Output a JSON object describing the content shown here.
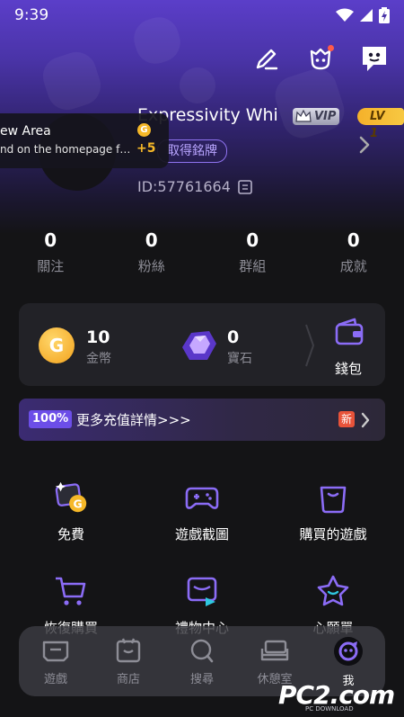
{
  "status_bar": {
    "time": "9:39"
  },
  "profile": {
    "nickname": "Expressivity Whi",
    "vip_label": "VIP",
    "level_label": "LV 1",
    "title_tag": "取得銘牌",
    "user_id": "ID:57761664"
  },
  "toast": {
    "title": "ew  Area",
    "body": "nd on the homepage for t...",
    "coin_letter": "G",
    "reward": "+5"
  },
  "stats": [
    {
      "value": "0",
      "label": "關注"
    },
    {
      "value": "0",
      "label": "粉絲"
    },
    {
      "value": "0",
      "label": "群組"
    },
    {
      "value": "0",
      "label": "成就"
    }
  ],
  "wallet": {
    "coin_letter": "G",
    "coins_value": "10",
    "coins_label": "金幣",
    "gems_value": "0",
    "gems_label": "寶石",
    "wallet_label": "錢包"
  },
  "recharge": {
    "badge": "100%",
    "text": "更多充值詳情>>>",
    "new_badge": "新"
  },
  "grid": [
    {
      "label": "免費",
      "icon": "free-gift-icon"
    },
    {
      "label": "遊戲截圖",
      "icon": "gamepad-icon"
    },
    {
      "label": "購買的遊戲",
      "icon": "shopping-bag-icon"
    },
    {
      "label": "恢復購買",
      "icon": "cart-icon"
    },
    {
      "label": "禮物中心",
      "icon": "gift-center-icon"
    },
    {
      "label": "心願單",
      "icon": "wishlist-star-icon"
    }
  ],
  "bottom_nav": [
    {
      "label": "遊戲",
      "icon": "game-icon"
    },
    {
      "label": "商店",
      "icon": "store-icon"
    },
    {
      "label": "搜尋",
      "icon": "search-icon"
    },
    {
      "label": "休憩室",
      "icon": "lounge-icon"
    },
    {
      "label": "我",
      "icon": "me-icon"
    }
  ],
  "watermark": {
    "text": "PC2.com",
    "sub": "PC DOWNLOAD"
  },
  "colors": {
    "accent": "#8b6cf6",
    "gold": "#f6b828",
    "vip_silver": "#c9c9d6",
    "background": "#141416",
    "card": "#222227"
  }
}
